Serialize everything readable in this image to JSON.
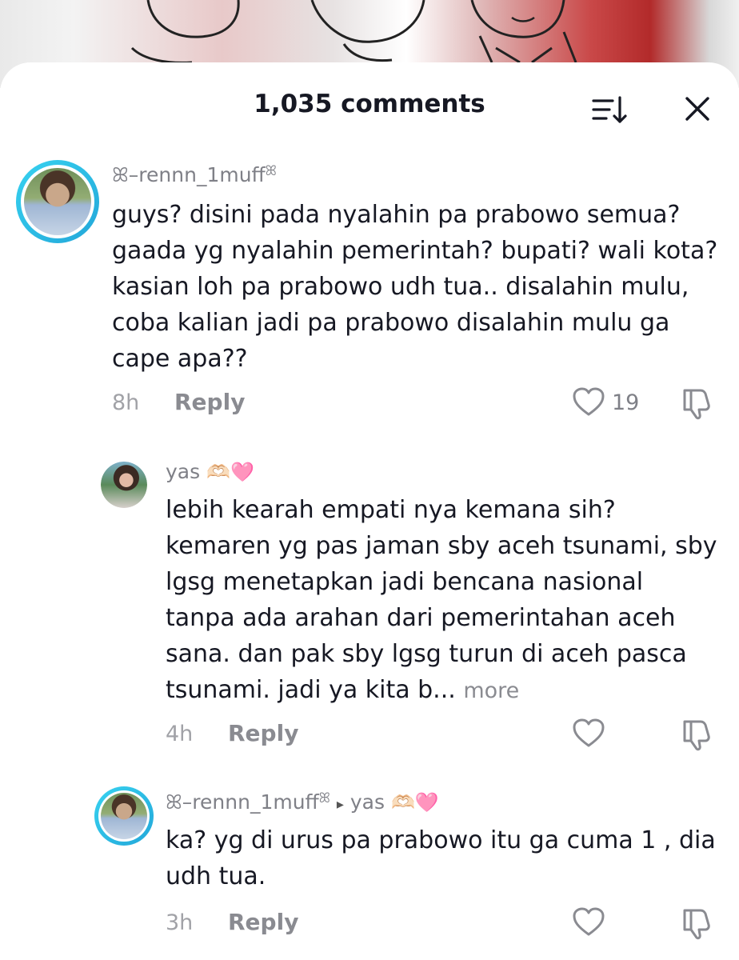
{
  "header": {
    "title": "1,035 comments",
    "icons": [
      "sort-icon",
      "close-icon"
    ]
  },
  "comments": [
    {
      "username": "ꕤ–rennn_1muff",
      "username_suffix": "ꕤ",
      "lines": [
        "guys? disini pada nyalahin pa prabowo semua?",
        "gaada yg nyalahin pemerintah? bupati? wali kota?",
        "kasian loh pa prabowo udh tua.. disalahin mulu,",
        "coba kalian jadi pa prabowo disalahin mulu ga",
        "cape apa??"
      ],
      "time": "8h",
      "reply_label": "Reply",
      "likes": "19"
    },
    {
      "username": "yas",
      "username_emoji": "🫶🏻🩷",
      "lines": [
        "lebih kearah empati nya kemana sih?",
        "kemaren yg pas jaman sby aceh tsunami, sby",
        "lgsg menetapkan jadi bencana nasional",
        "tanpa ada arahan dari pemerintahan aceh",
        "sana. dan pak sby lgsg turun di aceh pasca",
        "tsunami. jadi ya kita b..."
      ],
      "more_label": "more",
      "time": "4h",
      "reply_label": "Reply"
    },
    {
      "username": "ꕤ–rennn_1muff",
      "username_suffix": "ꕤ",
      "reply_to_arrow": "▸",
      "reply_to": "yas",
      "reply_to_emoji": "🫶🏻🩷",
      "lines": [
        "ka? yg di urus pa prabowo itu ga cuma 1 , dia",
        "udh tua."
      ],
      "time": "3h",
      "reply_label": "Reply"
    }
  ],
  "colors": {
    "text": "#161823",
    "secondary": "#7f8087",
    "ring": "#2ab8e3"
  }
}
